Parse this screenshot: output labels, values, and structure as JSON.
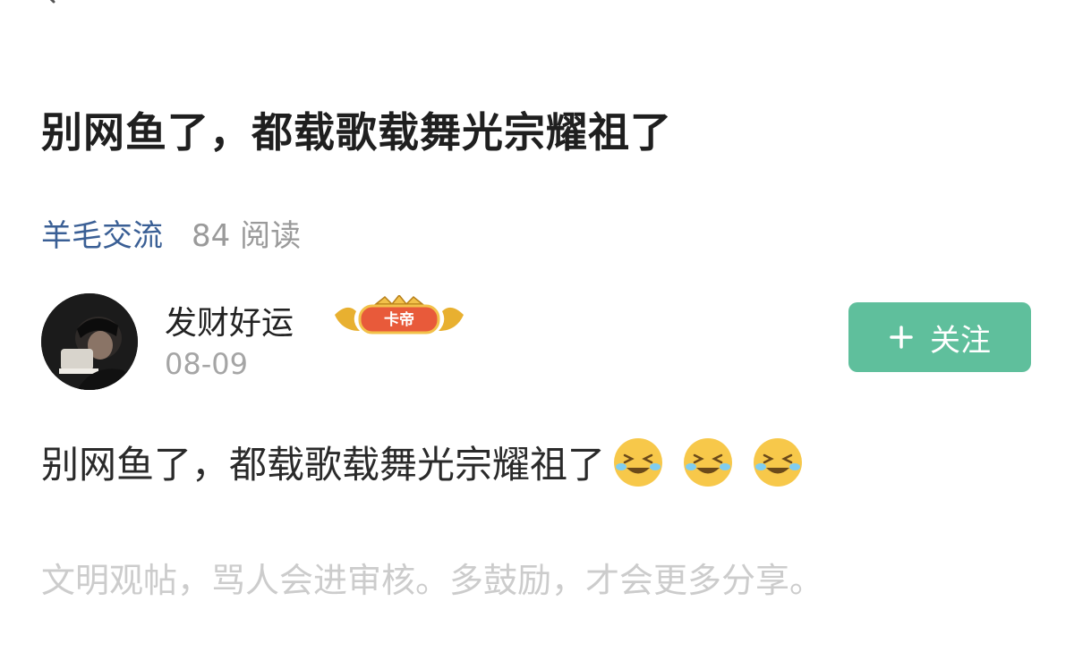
{
  "nav": {
    "back_icon": "back-chevron-icon"
  },
  "post": {
    "title": "别网鱼了，都载歌载舞光宗耀祖了",
    "category": "羊毛交流",
    "read_count": "84 阅读",
    "body_text": "别网鱼了，都载歌载舞光宗耀祖了",
    "emojis": [
      "grinning-tears-emoji",
      "grinning-tears-emoji",
      "grinning-tears-emoji"
    ]
  },
  "author": {
    "name": "发财好运",
    "badge_label": "卡帝",
    "date": "08-09",
    "avatar": "user-avatar"
  },
  "follow": {
    "label": "关注",
    "icon": "plus-icon",
    "color": "#5fbf9c"
  },
  "comment_hint": "文明观帖，骂人会进审核。多鼓励，才会更多分享。",
  "colors": {
    "category": "#3a5f95",
    "muted": "#9a9a9a",
    "hint": "#cccccc"
  }
}
